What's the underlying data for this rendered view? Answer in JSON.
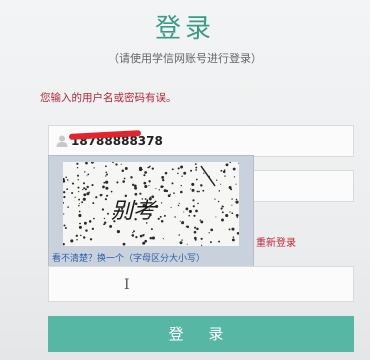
{
  "page": {
    "title": "登录",
    "subtitle": "（请使用学信网账号进行登录）",
    "error_message": "您输入的用户名或密码有误。"
  },
  "form": {
    "username_value": "18788888378",
    "relogin_link": "重新登录",
    "login_button": "登 录"
  },
  "captcha": {
    "image_text": "别考",
    "hint_prefix": "看不清楚？",
    "refresh_link": "换一个",
    "hint_suffix": "（字母区分大小写）"
  },
  "colors": {
    "title": "#3a9c85",
    "error": "#b0283a",
    "button": "#55b7a4",
    "link": "#2d5ea6"
  },
  "icons": [
    "user-icon",
    "text-cursor-icon"
  ]
}
